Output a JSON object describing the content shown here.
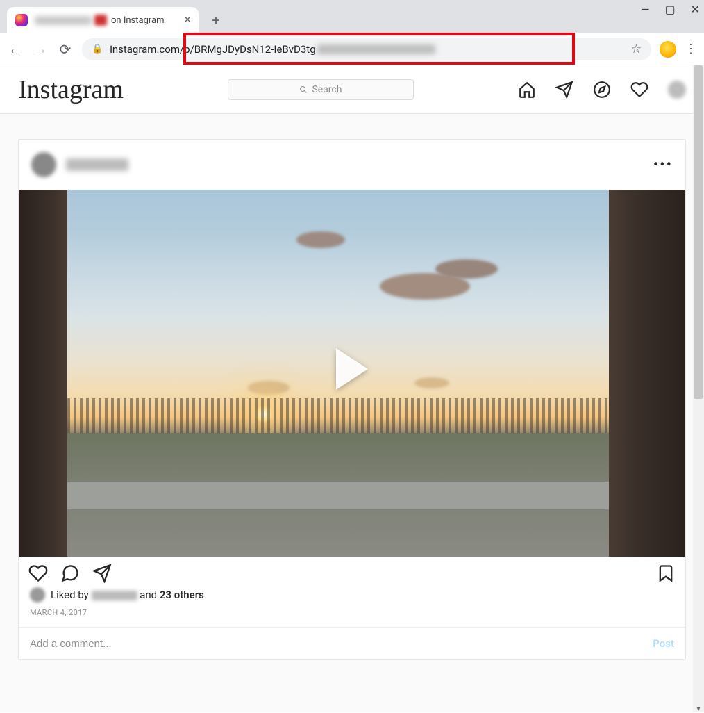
{
  "browser": {
    "tab_suffix": "on Instagram",
    "new_tab": "+",
    "window_controls": {
      "minimize": "—",
      "maximize": "▢",
      "close": "✕"
    },
    "nav": {
      "back": "←",
      "forward": "→",
      "reload": "⟳"
    },
    "url_visible": "instagram.com/p/BRMgJDyDsN12-IeBvD3tg",
    "lock": "🔒",
    "star": "☆",
    "kebab": "⋮"
  },
  "instagram": {
    "logo_text": "Instagram",
    "search_placeholder": "Search",
    "nav_icons": [
      "home-icon",
      "send-icon",
      "explore-icon",
      "heart-icon",
      "avatar"
    ]
  },
  "post": {
    "more": "•••",
    "actions": [
      "heart-icon",
      "comment-icon",
      "send-icon",
      "bookmark-icon"
    ],
    "likes_prefix": "Liked by",
    "likes_and": "and",
    "likes_others": "23 others",
    "date": "MARCH 4, 2017",
    "comment_placeholder": "Add a comment...",
    "post_button": "Post"
  }
}
